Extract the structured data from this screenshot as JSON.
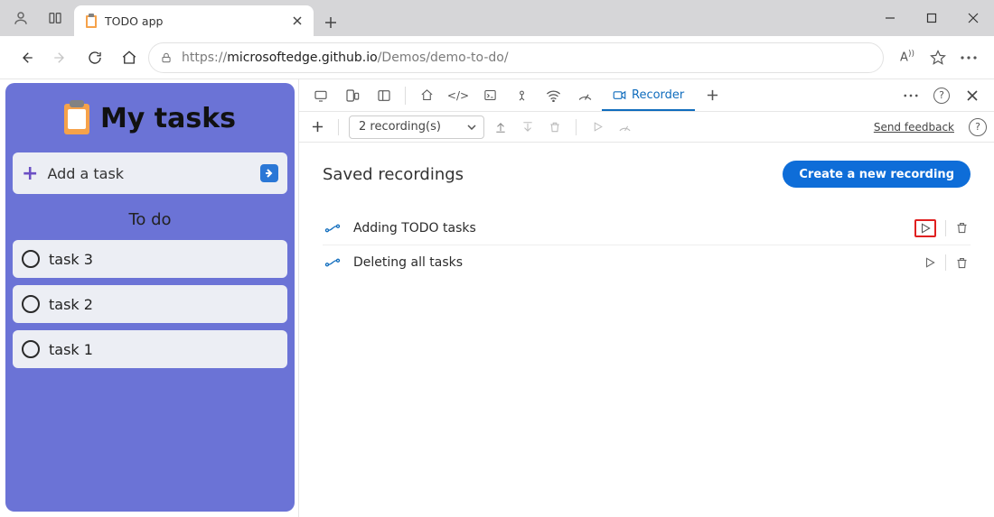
{
  "browser": {
    "tab_title": "TODO app",
    "url_host": "microsoftedge.github.io",
    "url_prefix": "https://",
    "url_path": "/Demos/demo-to-do/"
  },
  "app": {
    "heading": "My tasks",
    "add_placeholder": "Add a task",
    "section_label": "To do",
    "tasks": [
      "task 3",
      "task 2",
      "task 1"
    ]
  },
  "devtools": {
    "tab_label": "Recorder",
    "recordings_count_label": "2 recording(s)",
    "feedback_label": "Send feedback",
    "body_heading": "Saved recordings",
    "cta_label": "Create a new recording",
    "recordings": [
      {
        "name": "Adding TODO tasks",
        "highlight_play": true
      },
      {
        "name": "Deleting all tasks",
        "highlight_play": false
      }
    ]
  }
}
